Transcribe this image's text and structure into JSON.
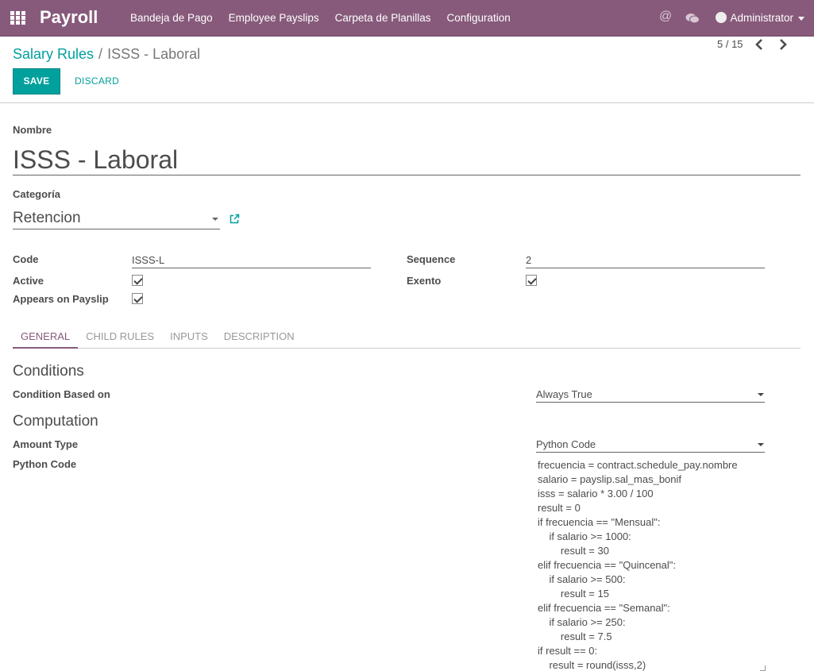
{
  "navbar": {
    "brand": "Payroll",
    "menu": [
      "Bandeja de Pago",
      "Employee Payslips",
      "Carpeta de Planillas",
      "Configuration"
    ],
    "user": "Administrator"
  },
  "breadcrumb": {
    "parent": "Salary Rules",
    "separator": "/",
    "current": "ISSS - Laboral"
  },
  "buttons": {
    "save": "SAVE",
    "discard": "DISCARD"
  },
  "pager": "5 / 15",
  "form": {
    "nombre_label": "Nombre",
    "nombre_value": "ISSS - Laboral",
    "categoria_label": "Categoría",
    "categoria_value": "Retencion",
    "code_label": "Code",
    "code_value": "ISSS-L",
    "sequence_label": "Sequence",
    "sequence_value": "2",
    "active_label": "Active",
    "active_checked": true,
    "exento_label": "Exento",
    "exento_checked": true,
    "appears_label": "Appears on Payslip",
    "appears_checked": true
  },
  "tabs": [
    "GENERAL",
    "CHILD RULES",
    "INPUTS",
    "DESCRIPTION"
  ],
  "active_tab": "GENERAL",
  "general": {
    "conditions_title": "Conditions",
    "condition_label": "Condition Based on",
    "condition_value": "Always True",
    "computation_title": "Computation",
    "amount_type_label": "Amount Type",
    "amount_type_value": "Python Code",
    "python_code_label": "Python Code",
    "python_code": "frecuencia = contract.schedule_pay.nombre\nsalario = payslip.sal_mas_bonif\nisss = salario * 3.00 / 100\nresult = 0\nif frecuencia == \"Mensual\":\n    if salario >= 1000:\n        result = 30\nelif frecuencia == \"Quincenal\":\n    if salario >= 500:\n        result = 15\nelif frecuencia == \"Semanal\":\n    if salario >= 250:\n        result = 7.5\nif result == 0:\n    result = round(isss,2)"
  },
  "colors": {
    "navbar": "#875a7b",
    "accent": "#00a09d"
  },
  "icons": [
    "apps-icon",
    "at-icon",
    "chat-icon",
    "external-link-icon",
    "chevron-left-icon",
    "chevron-right-icon"
  ]
}
